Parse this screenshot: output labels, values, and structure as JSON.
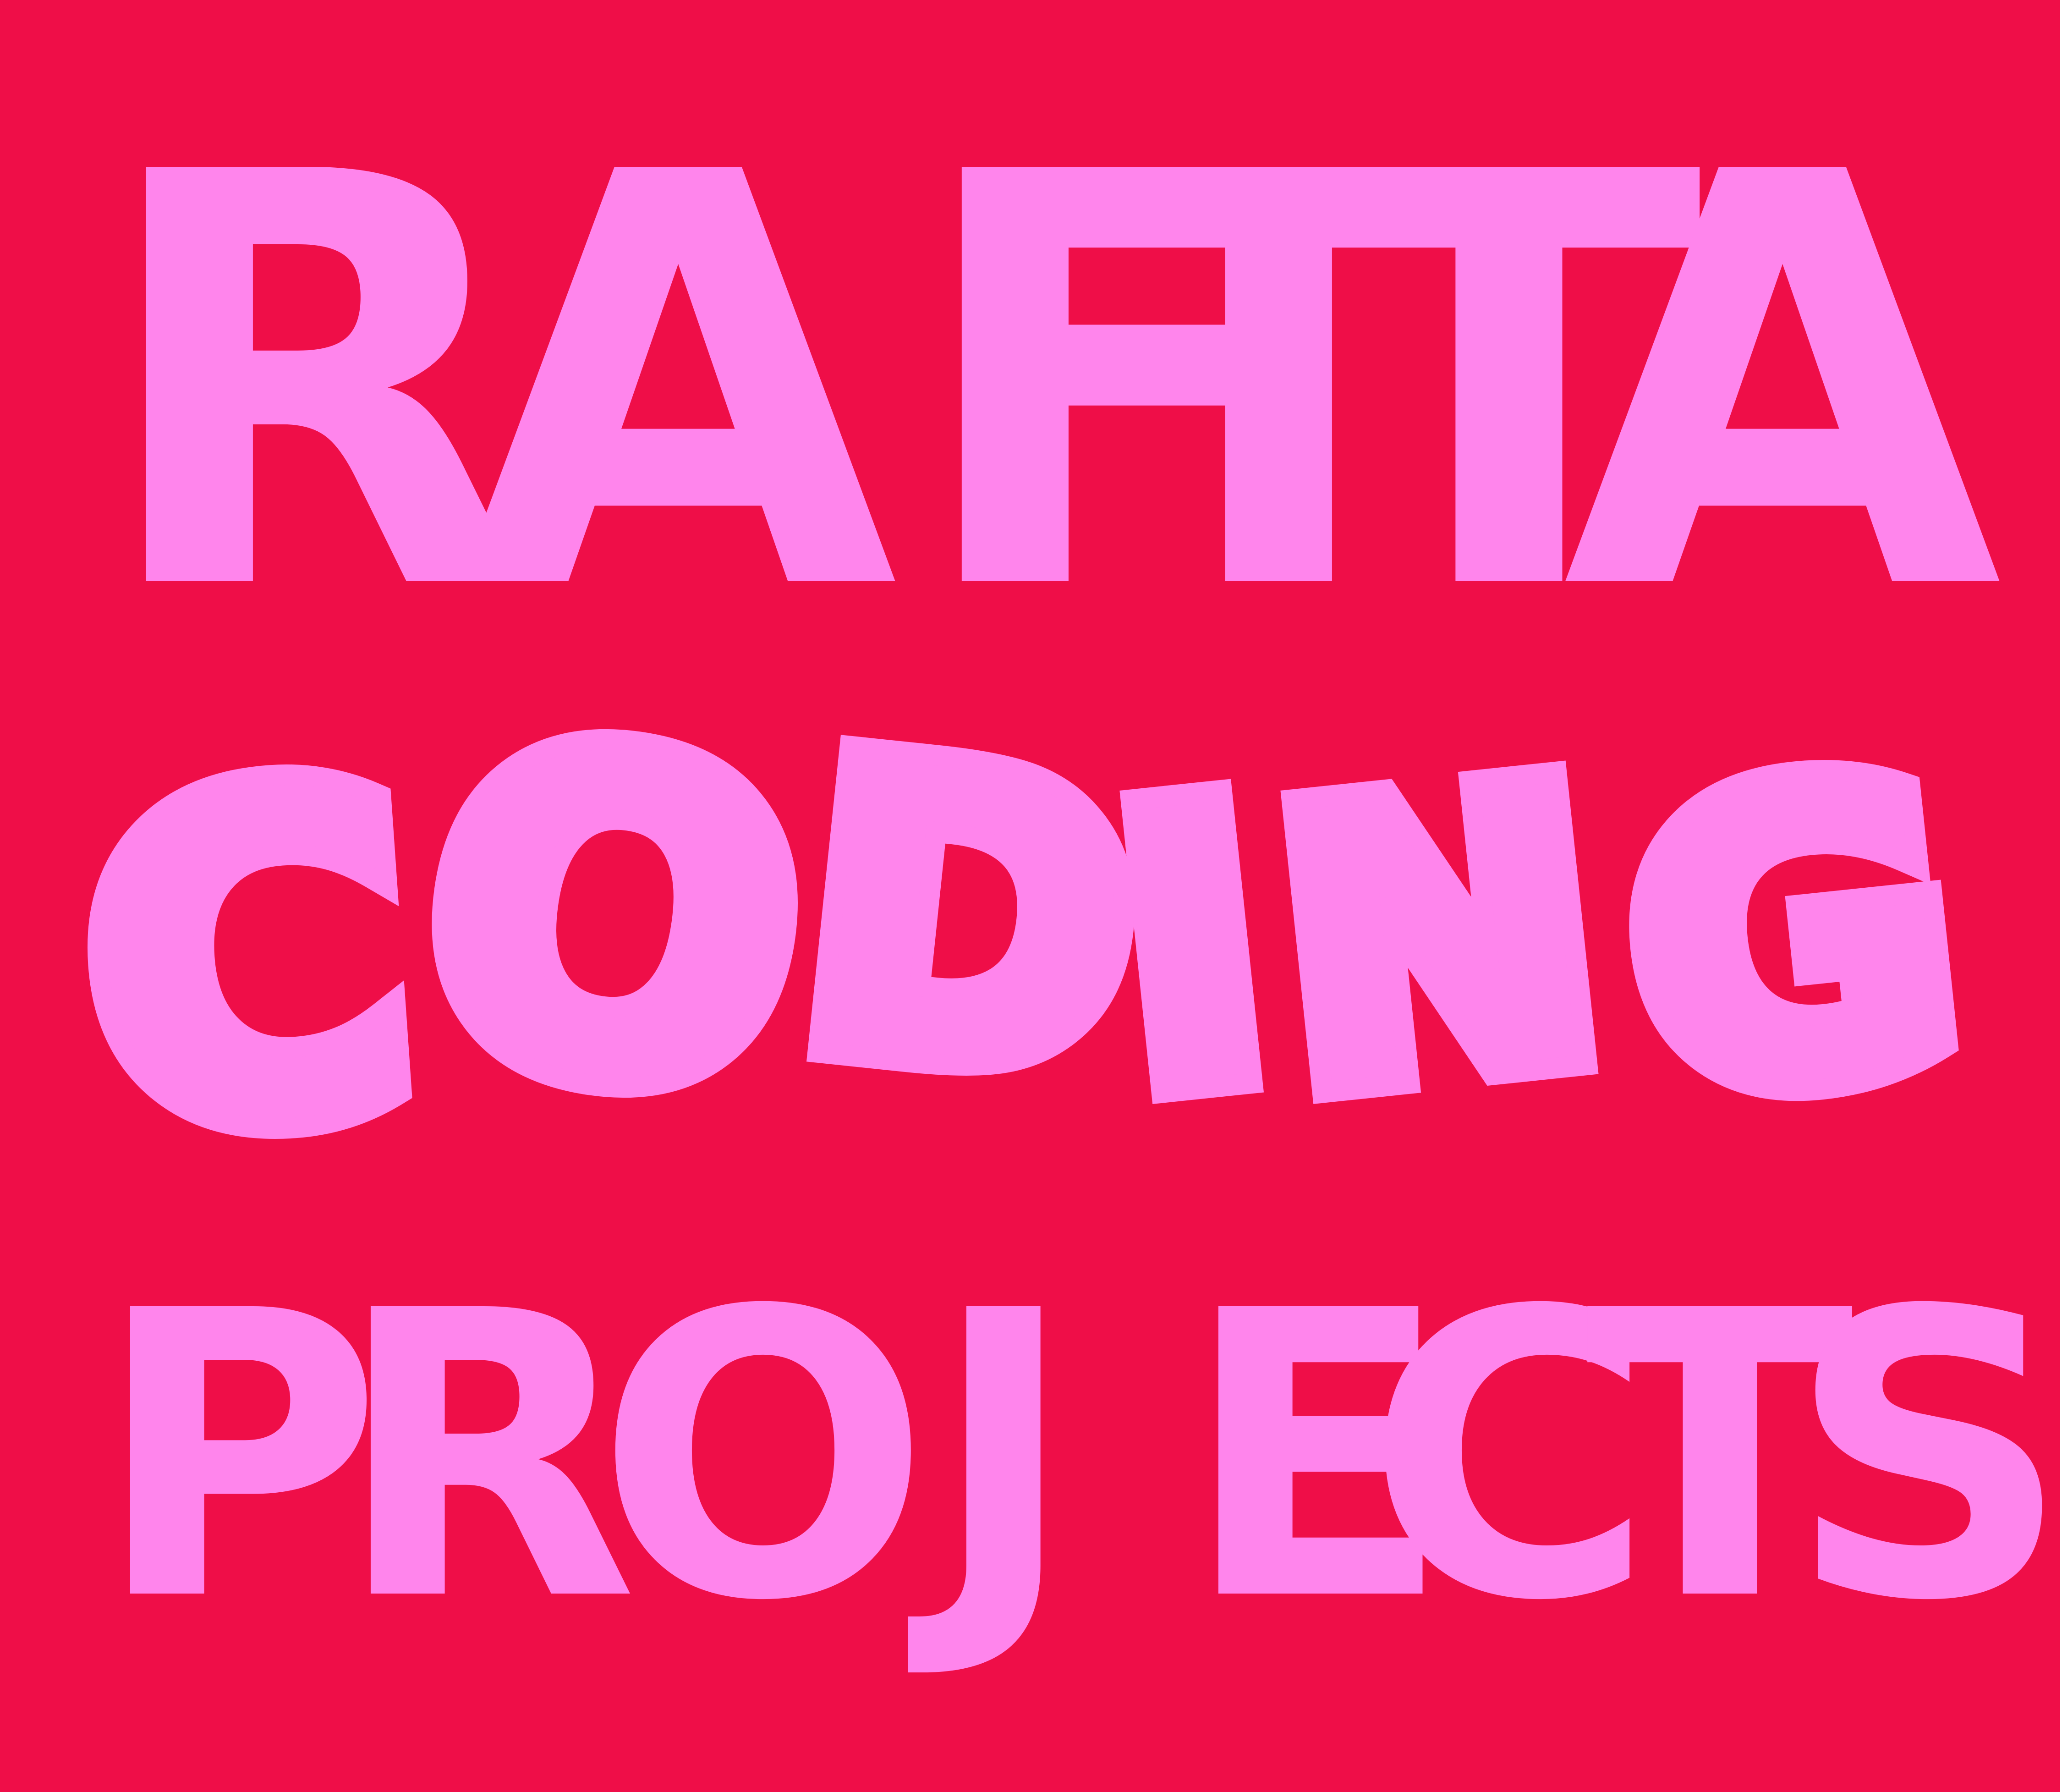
{
  "logo": {
    "line1": [
      "R",
      "A",
      "F",
      "I",
      "T",
      "A"
    ],
    "line2": [
      "C",
      "O",
      "D",
      "I",
      "N",
      "G"
    ],
    "line3": [
      "P",
      "R",
      "O",
      "J",
      "E",
      "C",
      "T",
      "S"
    ]
  },
  "colors": {
    "background": "#ef0e48",
    "lettering": "#ff85ec"
  }
}
